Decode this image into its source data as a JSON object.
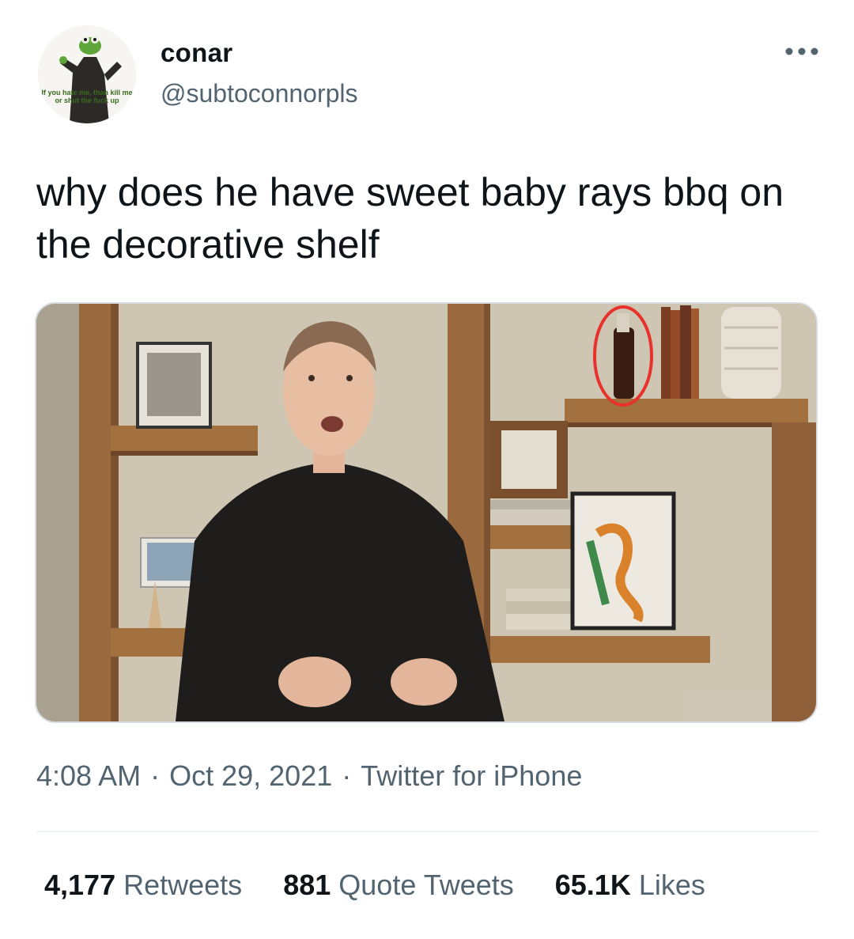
{
  "tweet": {
    "author": {
      "display_name": "conar",
      "handle": "@subtoconnorpls",
      "avatar_caption_line1": "If you hate me, than kill me",
      "avatar_caption_line2": "or shut the fuck up"
    },
    "text": "why does he have sweet baby rays bbq on the decorative shelf",
    "timestamp": {
      "time": "4:08 AM",
      "date": "Oct 29, 2021",
      "source": "Twitter for iPhone",
      "separator": "·"
    },
    "stats": {
      "retweets": {
        "count": "4,177",
        "label": "Retweets"
      },
      "quote_tweets": {
        "count": "881",
        "label": "Quote Tweets"
      },
      "likes": {
        "count": "65.1K",
        "label": "Likes"
      }
    },
    "media": {
      "alt_icon": "photo"
    }
  },
  "icons": {
    "more": "more-horizontal-icon",
    "avatar": "kermit-avatar"
  },
  "colors": {
    "text_primary": "#0f1419",
    "text_secondary": "#536471",
    "divider": "#eff3f4",
    "annotation_circle": "#e8312b"
  }
}
